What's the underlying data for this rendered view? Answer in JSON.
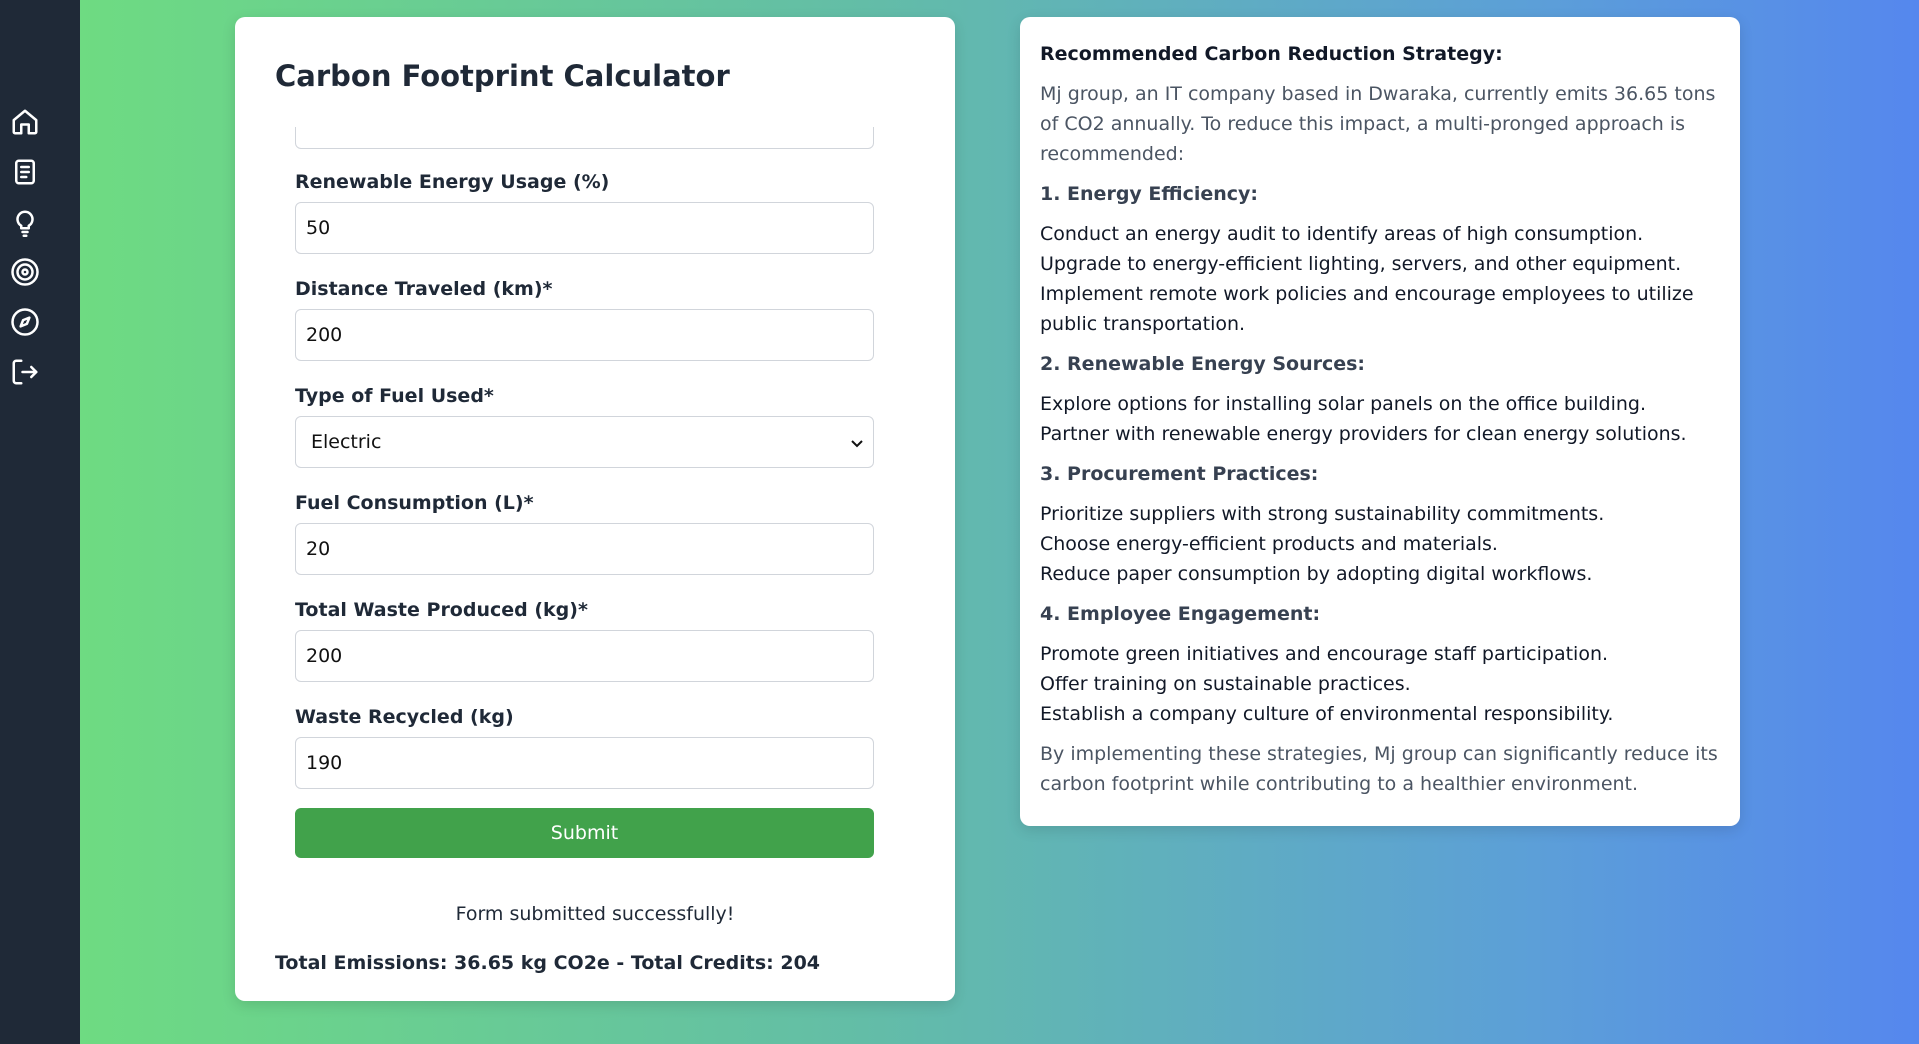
{
  "sidebar": {
    "items": [
      {
        "icon": "home-icon"
      },
      {
        "icon": "document-icon"
      },
      {
        "icon": "lightbulb-icon"
      },
      {
        "icon": "target-icon"
      },
      {
        "icon": "compass-icon"
      },
      {
        "icon": "logout-icon"
      }
    ]
  },
  "calculator": {
    "title": "Carbon Footprint Calculator",
    "fields": [
      {
        "label": "Renewable Energy Usage (%)",
        "value": "50"
      },
      {
        "label": "Distance Traveled (km)*",
        "value": "200"
      },
      {
        "label": "Type of Fuel Used*",
        "value": "Electric"
      },
      {
        "label": "Fuel Consumption (L)*",
        "value": "20"
      },
      {
        "label": "Total Waste Produced (kg)*",
        "value": "200"
      },
      {
        "label": "Waste Recycled (kg)",
        "value": "190"
      }
    ],
    "submit_label": "Submit",
    "success_message": "Form submitted successfully!",
    "totals": "Total Emissions: 36.65 kg CO2e - Total Credits: 204"
  },
  "strategy": {
    "heading": "Recommended Carbon Reduction Strategy:",
    "intro": "Mj group, an IT company based in Dwaraka, currently emits 36.65 tons of CO2 annually. To reduce this impact, a multi-pronged approach is recommended:",
    "sections": [
      {
        "title": "1. Energy Efficiency:",
        "lines": [
          "Conduct an energy audit to identify areas of high consumption.",
          "Upgrade to energy-efficient lighting, servers, and other equipment.",
          "Implement remote work policies and encourage employees to utilize public transportation."
        ]
      },
      {
        "title": "2. Renewable Energy Sources:",
        "lines": [
          "Explore options for installing solar panels on the office building.",
          "Partner with renewable energy providers for clean energy solutions."
        ]
      },
      {
        "title": "3. Procurement Practices:",
        "lines": [
          "Prioritize suppliers with strong sustainability commitments.",
          "Choose energy-efficient products and materials.",
          "Reduce paper consumption by adopting digital workflows."
        ]
      },
      {
        "title": "4. Employee Engagement:",
        "lines": [
          "Promote green initiatives and encourage staff participation.",
          "Offer training on sustainable practices.",
          "Establish a company culture of environmental responsibility."
        ]
      }
    ],
    "closing": "By implementing these strategies, Mj group can significantly reduce its carbon footprint while contributing to a healthier environment."
  },
  "colors": {
    "sidebar": "#1f2937",
    "submit": "#41a24b",
    "gradient_start": "#6fde7e",
    "gradient_end": "#5587ee"
  }
}
